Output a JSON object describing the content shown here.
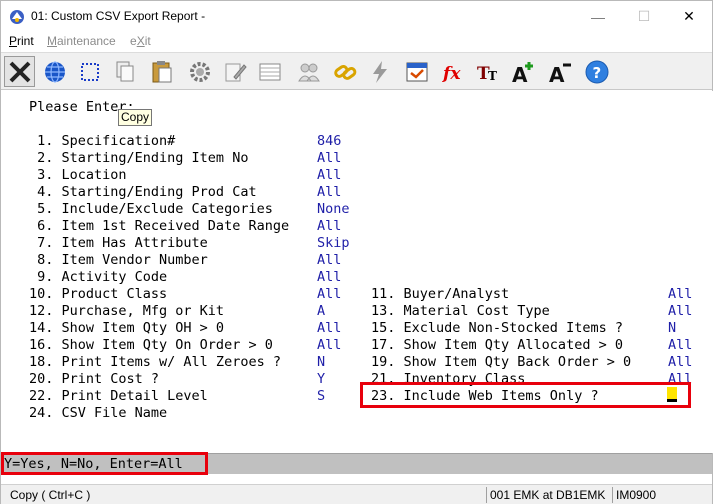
{
  "window": {
    "title": "01: Custom CSV Export Report -",
    "minimize": "—",
    "maximize": "☐",
    "close": "✕"
  },
  "menu": {
    "print": "Print",
    "maintenance": "Maintenance",
    "exit": "eXit"
  },
  "toolbar_icons": [
    "close-x",
    "globe",
    "select-box",
    "copy",
    "paste",
    "settings",
    "edit",
    "table",
    "users",
    "link",
    "lightning",
    "calendar",
    "function",
    "font-size",
    "font-grow",
    "font-shrink",
    "help"
  ],
  "tooltip": "Copy",
  "prompt": "Please Enter:",
  "left_fields": [
    {
      "n": " 1.",
      "label": "Specification#",
      "value": "846"
    },
    {
      "n": " 2.",
      "label": "Starting/Ending Item No",
      "value": "All"
    },
    {
      "n": " 3.",
      "label": "Location",
      "value": "All"
    },
    {
      "n": " 4.",
      "label": "Starting/Ending Prod Cat",
      "value": "All"
    },
    {
      "n": " 5.",
      "label": "Include/Exclude Categories",
      "value": "None"
    },
    {
      "n": " 6.",
      "label": "Item 1st Received Date Range",
      "value": "All"
    },
    {
      "n": " 7.",
      "label": "Item Has Attribute",
      "value": "Skip"
    },
    {
      "n": " 8.",
      "label": "Item Vendor Number",
      "value": "All"
    },
    {
      "n": " 9.",
      "label": "Activity Code",
      "value": "All"
    },
    {
      "n": "10.",
      "label": "Product Class",
      "value": "All"
    },
    {
      "n": "12.",
      "label": "Purchase, Mfg or Kit",
      "value": "A"
    },
    {
      "n": "14.",
      "label": "Show Item Qty OH > 0",
      "value": "All"
    },
    {
      "n": "16.",
      "label": "Show Item Qty On Order > 0",
      "value": "All"
    },
    {
      "n": "18.",
      "label": "Print Items w/ All Zeroes ?",
      "value": "N"
    },
    {
      "n": "20.",
      "label": "Print Cost ?",
      "value": "Y"
    },
    {
      "n": "22.",
      "label": "Print Detail Level",
      "value": "S"
    },
    {
      "n": "24.",
      "label": "CSV File Name",
      "value": ""
    }
  ],
  "right_fields": [
    {
      "n": "11.",
      "label": "Buyer/Analyst",
      "value": "All"
    },
    {
      "n": "13.",
      "label": "Material Cost Type",
      "value": "All"
    },
    {
      "n": "15.",
      "label": "Exclude Non-Stocked Items ?",
      "value": "N"
    },
    {
      "n": "17.",
      "label": "Show Item Qty Allocated > 0",
      "value": "All"
    },
    {
      "n": "19.",
      "label": "Show Item Qty Back Order > 0",
      "value": "All"
    },
    {
      "n": "21.",
      "label": "Inventory Class",
      "value": "All"
    },
    {
      "n": "23.",
      "label": "Include Web Items Only ?",
      "value": ""
    }
  ],
  "help_text": "Y=Yes, N=No, Enter=All",
  "status": {
    "hint": "Copy ( Ctrl+C )",
    "session": "001 EMK at DB1EMK",
    "program": "IM0900"
  },
  "colors": {
    "value_text": "#1f1fa8",
    "highlight_border": "#e8000c",
    "cursor": "#ffe400"
  }
}
